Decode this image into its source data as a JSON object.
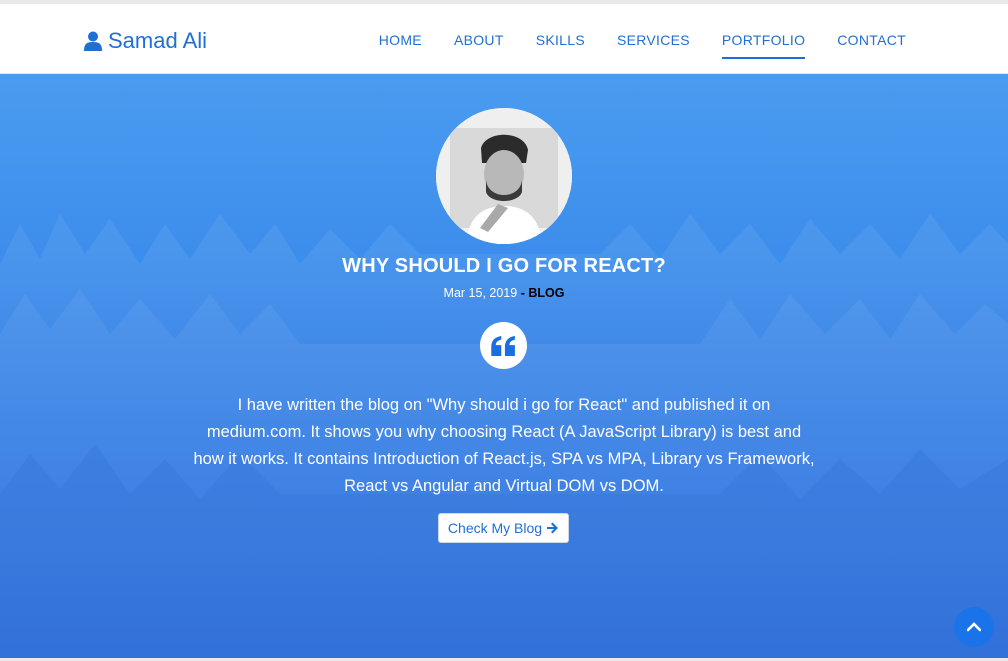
{
  "brand": {
    "name": "Samad Ali",
    "icon": "user-icon"
  },
  "nav": {
    "items": [
      {
        "label": "HOME"
      },
      {
        "label": "ABOUT"
      },
      {
        "label": "SKILLS"
      },
      {
        "label": "SERVICES"
      },
      {
        "label": "PORTFOLIO",
        "active": true
      },
      {
        "label": "CONTACT"
      }
    ]
  },
  "post": {
    "title": "WHY SHOULD I GO FOR REACT?",
    "date": "Mar 15, 2019",
    "separator": " - ",
    "category": "BLOG",
    "quote_icon": "quote-left-icon",
    "description": "I have written the blog on \"Why should i go for React\" and published it on medium.com. It shows you why choosing React (A JavaScript Library) is best and how it works. It contains Introduction of React.js, SPA vs MPA, Library vs Framework, React vs Angular and Virtual DOM vs DOM.",
    "button_label": "Check My Blog"
  },
  "colors": {
    "accent": "#1f6fd4",
    "hero_top": "#4a9cf0",
    "hero_bottom": "#1a63db",
    "scroll_button": "#1a73e8"
  }
}
